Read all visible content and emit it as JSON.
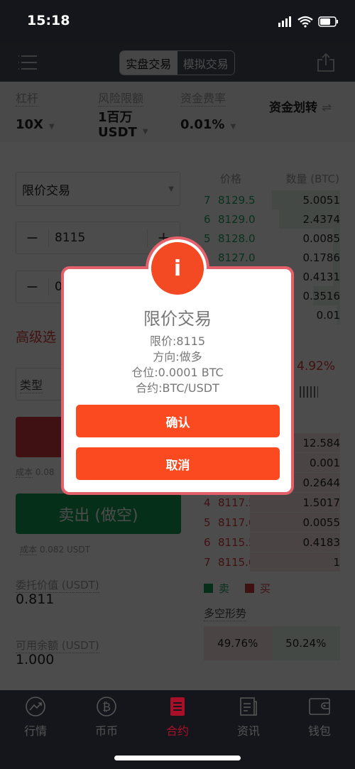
{
  "status_bar": {
    "time": "15:18"
  },
  "nav": {
    "tabs": [
      {
        "label": "实盘交易",
        "active": true
      },
      {
        "label": "模拟交易",
        "active": false
      }
    ]
  },
  "info": {
    "leverage_label": "杠杆",
    "leverage": "10X",
    "risk_label": "风险限额",
    "risk_line1": "1百万",
    "risk_line2": "USDT",
    "fee_label": "资金费率",
    "fee": "0.01%",
    "transfer": "资金划转",
    "transfer_icon": "⇌"
  },
  "form": {
    "order_type": "限价交易",
    "price": "8115",
    "qty_partial": "0",
    "advanced_partial": "高级选",
    "type_label": "类型",
    "buy_cost_label": "成本",
    "buy_cost_partial": "0.08",
    "sell_button": "卖出 (做空)",
    "sell_cost_label": "成本",
    "sell_cost": "0.082 USDT",
    "order_value_label": "委托价值 (USDT)",
    "order_value": "0.811",
    "balance_label": "可用余额 (USDT)",
    "balance": "1.000"
  },
  "orderbook": {
    "price_header": "价格",
    "qty_header": "数量 (BTC)",
    "asks": [
      {
        "n": "7",
        "price": "8129.5",
        "qty": "5.0051",
        "depth": 0.5
      },
      {
        "n": "6",
        "price": "8129.0",
        "qty": "2.4374",
        "depth": 0.45
      },
      {
        "n": "5",
        "price": "8128.0",
        "qty": "0.0085",
        "depth": 0.05
      },
      {
        "n": "",
        "price": "8127.0",
        "qty": "0.1786",
        "depth": 0.05
      },
      {
        "n": "",
        "price": "",
        "qty": "0.4131",
        "depth": 0.05
      },
      {
        "n": "",
        "price": "",
        "qty": "0.3516",
        "depth": 0.2
      },
      {
        "n": "",
        "price": "",
        "qty": "0.01",
        "depth": 0.02
      }
    ],
    "change_partial": "4.92%",
    "bids": [
      {
        "n": "",
        "price": "",
        "qty": "12.584",
        "depth": 0.9
      },
      {
        "n": "",
        "price": "",
        "qty": "0.001",
        "depth": 0.9
      },
      {
        "n": "",
        "price": "",
        "qty": "0.2644",
        "depth": 0.9
      },
      {
        "n": "4",
        "price": "8117.5",
        "qty": "1.5017",
        "depth": 0.66
      },
      {
        "n": "5",
        "price": "8117.0",
        "qty": "0.0055",
        "depth": 0.66
      },
      {
        "n": "6",
        "price": "8115.5",
        "qty": "0.4183",
        "depth": 0.66
      },
      {
        "n": "7",
        "price": "8115.0",
        "qty": "1",
        "depth": 0.66
      }
    ],
    "legend_sell": "卖",
    "legend_buy": "买",
    "sentiment_label": "多空形势",
    "long_pct": "49.76%",
    "short_pct": "50.24%",
    "long_value": 49.76
  },
  "modal": {
    "title": "限价交易",
    "lines": [
      "限价:8115",
      "方向:做多",
      "仓位:0.0001 BTC",
      "合约:BTC/USDT"
    ],
    "confirm": "确认",
    "cancel": "取消",
    "accent": "#fb4a1f"
  },
  "tabbar": {
    "items": [
      {
        "label": "行情",
        "icon": "chart-icon"
      },
      {
        "label": "币币",
        "icon": "bitcoin-icon"
      },
      {
        "label": "合约",
        "icon": "contract-icon",
        "active": true
      },
      {
        "label": "资讯",
        "icon": "news-icon"
      },
      {
        "label": "钱包",
        "icon": "wallet-icon"
      }
    ]
  }
}
